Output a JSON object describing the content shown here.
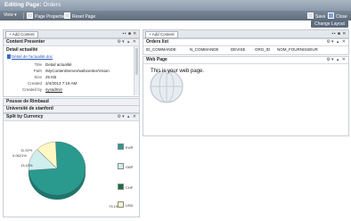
{
  "title": {
    "prefix": "Editing Page:",
    "page": "Orders"
  },
  "toolbar": {
    "view": "View ▾",
    "page_properties": "Page Properties",
    "reset_page": "Reset Page",
    "save": "Save",
    "close": "Close"
  },
  "change_layout": "Change Layout",
  "left_zone": {
    "add_content": "+ Add Content"
  },
  "right_zone": {
    "add_content": "+ Add Content"
  },
  "content_presenter": {
    "title": "Content Presenter",
    "section": "Detail actualité",
    "doc_name": "Détail de l'actualité.doc",
    "properties": [
      {
        "key": "Title",
        "value": "Detail actualité"
      },
      {
        "key": "Path",
        "value": "/MyContentServer/webcenter/Vision"
      },
      {
        "key": "Size",
        "value": "25 KB"
      },
      {
        "key": "Created",
        "value": "2/4/2013 7:18 AM"
      },
      {
        "key": "Created by",
        "value": "sysadmin"
      }
    ]
  },
  "collapsed_panes": [
    "Pousse de Rimbaud",
    "Université de stanford"
  ],
  "split_currency": {
    "title": "Split by Currency",
    "legend": [
      "EUR",
      "GBP",
      "CHF",
      "USD"
    ]
  },
  "orders_list": {
    "title": "Orders list",
    "columns": [
      "ID_COMMANDE",
      "N_COMMANDE",
      "DEVISE",
      "ORG_ID",
      "NOM_FOURNISSEUR"
    ]
  },
  "web_page": {
    "title": "Web Page",
    "text": "This is your web page."
  },
  "chart_data": {
    "type": "pie",
    "title": "Split by Currency",
    "categories": [
      "EUR",
      "GBP",
      "CHF",
      "USD"
    ],
    "values": [
      73.19,
      13.43,
      0.0621,
      11.32
    ],
    "labels": [
      "73.19%",
      "13.43%",
      "0.0621%",
      "11.32%"
    ],
    "colors": [
      "#2a9a8e",
      "#cfeeee",
      "#1b6e3f",
      "#fff8c4"
    ]
  }
}
